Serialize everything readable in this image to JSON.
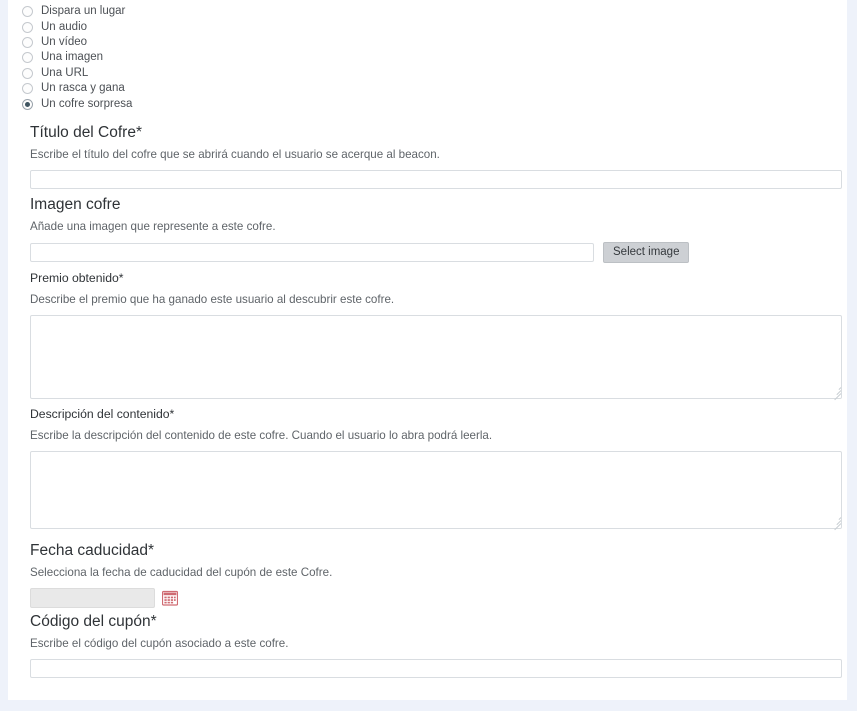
{
  "theme": {
    "page_background": "#eef2fa",
    "panel_background": "#ffffff",
    "border_color": "#d9dde1",
    "heading_color": "#2f3337",
    "help_text_color": "#5f6469",
    "radio_selected_color": "#3f5561",
    "button_background": "#cdd0d4",
    "calendar_icon_color": "#cf6b72"
  },
  "content_type_options": {
    "items": [
      {
        "label": "Dispara un lugar",
        "selected": false
      },
      {
        "label": "Un audio",
        "selected": false
      },
      {
        "label": "Un vídeo",
        "selected": false
      },
      {
        "label": "Una imagen",
        "selected": false
      },
      {
        "label": "Una URL",
        "selected": false
      },
      {
        "label": "Un rasca y gana",
        "selected": false
      },
      {
        "label": "Un cofre sorpresa",
        "selected": true
      }
    ]
  },
  "form": {
    "title_field": {
      "label": "Título del Cofre*",
      "help": "Escribe el título del cofre que se abrirá cuando el usuario se acerque al beacon.",
      "value": "",
      "placeholder": ""
    },
    "image_field": {
      "label": "Imagen cofre",
      "help": "Añade una imagen que represente a este cofre.",
      "value": "",
      "placeholder": "",
      "button_label": "Select image"
    },
    "prize_field": {
      "label": "Premio obtenido*",
      "help": "Describe el premio que ha ganado este usuario al descubrir este cofre.",
      "value": "",
      "placeholder": ""
    },
    "description_field": {
      "label": "Descripción del contenido*",
      "help": "Escribe la descripción del contenido de este cofre. Cuando el usuario lo abra podrá leerla.",
      "value": "",
      "placeholder": ""
    },
    "expiry_field": {
      "label": "Fecha caducidad*",
      "help": "Selecciona la fecha de caducidad del cupón de este Cofre.",
      "value": "",
      "placeholder": "",
      "calendar_icon": "calendar-icon"
    },
    "coupon_field": {
      "label": "Código del cupón*",
      "help": "Escribe el código del cupón asociado a este cofre.",
      "value": "",
      "placeholder": ""
    }
  }
}
